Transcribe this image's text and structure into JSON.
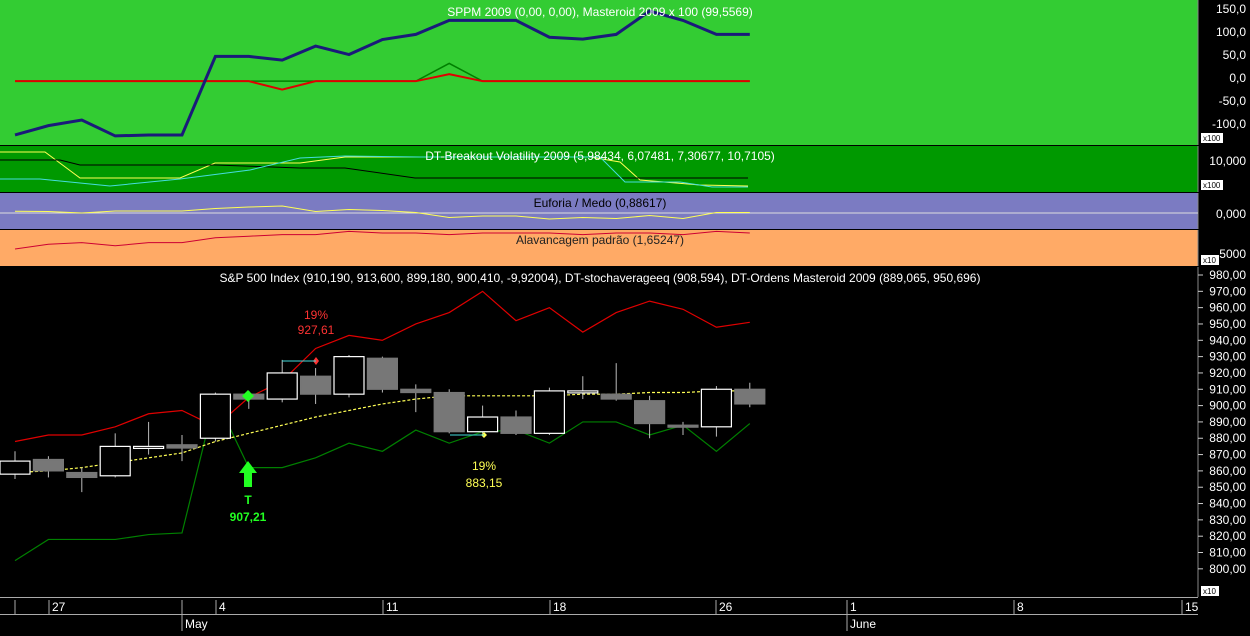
{
  "colors": {
    "panel_sppm_bg": "#33cc33",
    "panel_dtb_bg": "#009900",
    "panel_euforia_bg": "#7b7bc2",
    "panel_alav_bg": "#ffaa66",
    "panel_main_bg": "#000000",
    "axis_bg": "#000000",
    "navy": "#1a1a7a",
    "red": "#e00000",
    "green_line": "#008000",
    "yellow": "#ffff55",
    "cyan": "#44dddd",
    "white": "#ffffff"
  },
  "panels": {
    "sppm": {
      "title": "SPPM 2009 (0,00, 0,00), Masteroid 2009 x 100 (99,5569)",
      "ticks": [
        "150,0",
        "100,0",
        "50,0",
        "0,0",
        "-50,0",
        "-100,0"
      ],
      "scale_label": "x100"
    },
    "dtb": {
      "title": "DT-Breakout Volatility 2009 (5,98434, 6,07481, 7,30677, 10,7105)",
      "ticks": [
        "10,000"
      ],
      "scale_label": "x100"
    },
    "euforia": {
      "title": "Euforia / Medo (0,88617)",
      "ticks": [
        "0,000"
      ]
    },
    "alav": {
      "title": "Alavancagem padrão (1,65247)",
      "ticks": [
        "5000"
      ],
      "scale_label": "x10"
    },
    "main": {
      "title": "S&P 500 Index (910,190, 913,600, 899,180, 900,410, -9,92004), DT-stochaveragееq (908,594), DT-Ordens Masteroid 2009 (889,065, 950,696)",
      "scale_label": "x10"
    }
  },
  "annotations": {
    "sell_pct": "19%",
    "sell_price": "927,61",
    "buy_pct": "19%",
    "buy_price": "883,15",
    "entry_letter": "T",
    "entry_price": "907,21"
  },
  "x_axis": {
    "day_labels": [
      "27",
      "4",
      "11",
      "18",
      "26",
      "1",
      "8",
      "15"
    ],
    "month_labels": [
      "May",
      "June"
    ]
  },
  "chart_data": {
    "type": "candlestick",
    "title": "S&P 500 Index (910,190, 913,600, 899,180, 900,410, -9,92004), DT-stochaveragееq (908,594), DT-Ordens Masteroid 2009 (889,065, 950,696)",
    "ylim": [
      795,
      980
    ],
    "y_ticks": [
      980,
      970,
      960,
      950,
      940,
      930,
      920,
      910,
      900,
      890,
      880,
      870,
      860,
      850,
      840,
      830,
      820,
      810,
      800
    ],
    "y_tick_labels": [
      "980,00",
      "970,00",
      "960,00",
      "950,00",
      "940,00",
      "930,00",
      "920,00",
      "910,00",
      "900,00",
      "890,00",
      "880,00",
      "870,00",
      "860,00",
      "850,00",
      "840,00",
      "830,00",
      "820,00",
      "810,00",
      "800,00"
    ],
    "candles": [
      {
        "o": 858,
        "h": 872,
        "c": 866,
        "l": 855
      },
      {
        "o": 867,
        "h": 869,
        "c": 860,
        "l": 856
      },
      {
        "o": 859,
        "h": 862,
        "c": 856,
        "l": 847
      },
      {
        "o": 857,
        "h": 883,
        "c": 875,
        "l": 856
      },
      {
        "o": 875,
        "h": 890,
        "c": 875,
        "l": 870
      },
      {
        "o": 876,
        "h": 882,
        "c": 874,
        "l": 866
      },
      {
        "o": 880,
        "h": 908,
        "c": 907,
        "l": 878
      },
      {
        "o": 907,
        "h": 909,
        "c": 904,
        "l": 898
      },
      {
        "o": 904,
        "h": 928,
        "c": 920,
        "l": 902
      },
      {
        "o": 918,
        "h": 923,
        "c": 907,
        "l": 901
      },
      {
        "o": 907,
        "h": 931,
        "c": 930,
        "l": 905
      },
      {
        "o": 929,
        "h": 930,
        "c": 910,
        "l": 908
      },
      {
        "o": 910,
        "h": 913,
        "c": 908,
        "l": 896
      },
      {
        "o": 908,
        "h": 910,
        "c": 884,
        "l": 883
      },
      {
        "o": 884,
        "h": 900,
        "c": 893,
        "l": 883
      },
      {
        "o": 893,
        "h": 897,
        "c": 883,
        "l": 882
      },
      {
        "o": 883,
        "h": 911,
        "c": 909,
        "l": 882
      },
      {
        "o": 909,
        "h": 918,
        "c": 909,
        "l": 904
      },
      {
        "o": 907,
        "h": 926,
        "c": 904,
        "l": 903
      },
      {
        "o": 903,
        "h": 906,
        "c": 889,
        "l": 880
      },
      {
        "o": 888,
        "h": 890,
        "c": 887,
        "l": 882
      },
      {
        "o": 887,
        "h": 912,
        "c": 910,
        "l": 881
      },
      {
        "o": 910,
        "h": 914,
        "c": 901,
        "l": 899
      }
    ],
    "series": [
      {
        "name": "DT-Ordens Masteroid 2009 (upper)",
        "color": "#e00000",
        "values": [
          878,
          882,
          882,
          887,
          895,
          897,
          887,
          905,
          915,
          935,
          943,
          940,
          950,
          957,
          970,
          952,
          960,
          945,
          957,
          964,
          959,
          948,
          951
        ]
      },
      {
        "name": "DT-Ordens Masteroid 2009 (lower)",
        "color": "#008000",
        "values": [
          805,
          818,
          818,
          818,
          821,
          822,
          905,
          862,
          862,
          868,
          877,
          872,
          885,
          877,
          884,
          885,
          877,
          890,
          890,
          882,
          888,
          872,
          889
        ]
      },
      {
        "name": "DT-stochaveragееq",
        "color": "#ffff55",
        "dashed": true,
        "values": [
          859,
          860,
          862,
          865,
          868,
          871,
          878,
          883,
          888,
          893,
          897,
          901,
          904,
          906,
          906,
          906,
          906,
          907,
          907,
          908,
          908,
          909,
          909
        ]
      }
    ]
  },
  "indicator_data": {
    "sppm_range": [
      -130,
      165
    ],
    "sppm_masteroid": [
      -115,
      -95,
      -83,
      -117,
      -115,
      -115,
      53,
      53,
      45,
      75,
      57,
      89,
      100,
      130,
      130,
      130,
      94,
      90,
      100,
      150,
      130,
      100,
      100
    ],
    "sppm_red_x": [
      0,
      6,
      7,
      8,
      9,
      10,
      11,
      12,
      13,
      14,
      15,
      16,
      17,
      18,
      19,
      20,
      21,
      22
    ],
    "sppm_red": [
      0,
      0,
      0,
      -18,
      0,
      0,
      0,
      0,
      15,
      0,
      0,
      0,
      0,
      0,
      0,
      0,
      0,
      0
    ],
    "sppm_green": [
      0,
      0,
      0,
      0,
      0,
      0,
      0,
      0,
      38,
      0,
      0,
      0,
      0,
      0,
      0,
      0,
      0,
      0
    ],
    "euforia_yellow": [
      0.35,
      0.3,
      0,
      0.4,
      0.4,
      0.4,
      0.9,
      1.2,
      1.4,
      0.3,
      0.7,
      0.5,
      0.1,
      -0.9,
      -0.6,
      -0.6,
      -1.2,
      -0.9,
      -1.1,
      -0.5,
      -1.1,
      0.1,
      0.1
    ],
    "alav_red": [
      -0.5,
      -0.2,
      -0.1,
      -0.3,
      -0.1,
      -0.1,
      0.2,
      0.3,
      0.4,
      0.4,
      0.6,
      0.5,
      0.5,
      0.4,
      0.5,
      0.5,
      0.5,
      0.4,
      0.5,
      0.5,
      0.4,
      0.6,
      0.5
    ]
  }
}
